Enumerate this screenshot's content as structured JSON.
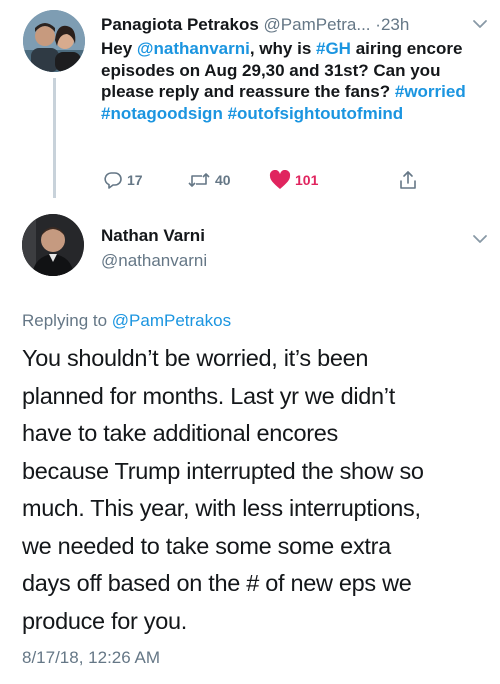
{
  "parent_tweet": {
    "author_name": "Panagiota Petrakos",
    "author_handle": "@PamPetra...",
    "separator": "·",
    "time": "23h",
    "text_parts": {
      "p1": "Hey ",
      "mention": "@nathanvarni",
      "p2": ", why is ",
      "tag_gh": "#GH",
      "p3": " airing encore episodes on Aug 29,30 and 31st? Can you please reply and reassure the fans? ",
      "tag_worried": "#worried",
      "p4": " ",
      "tag_notagoodsign": "#notagoodsign",
      "p5": " ",
      "tag_outofsight": "#outofsightoutofmind"
    },
    "actions": {
      "replies": "17",
      "retweets": "40",
      "likes": "101"
    },
    "icons": {
      "reply": "reply-icon",
      "retweet": "retweet-icon",
      "like": "heart-icon",
      "share": "share-icon",
      "menu": "chevron-down-icon"
    },
    "colors": {
      "like_active": "#e0245e",
      "link": "#1b95e0"
    }
  },
  "reply_tweet": {
    "author_name": "Nathan Varni",
    "author_handle": "@nathanvarni",
    "replying_label": "Replying to ",
    "replying_to": "@PamPetrakos",
    "lines": [
      "You shouldn’t be worried, it’s been",
      "planned for months. Last yr we didn’t",
      "have to take additional encores",
      "because Trump interrupted the show so",
      "much. This year, with less interruptions,",
      "we needed to take some some extra",
      "days off based on the # of new eps we",
      "produce for you."
    ],
    "timestamp": "8/17/18, 12:26 AM"
  }
}
